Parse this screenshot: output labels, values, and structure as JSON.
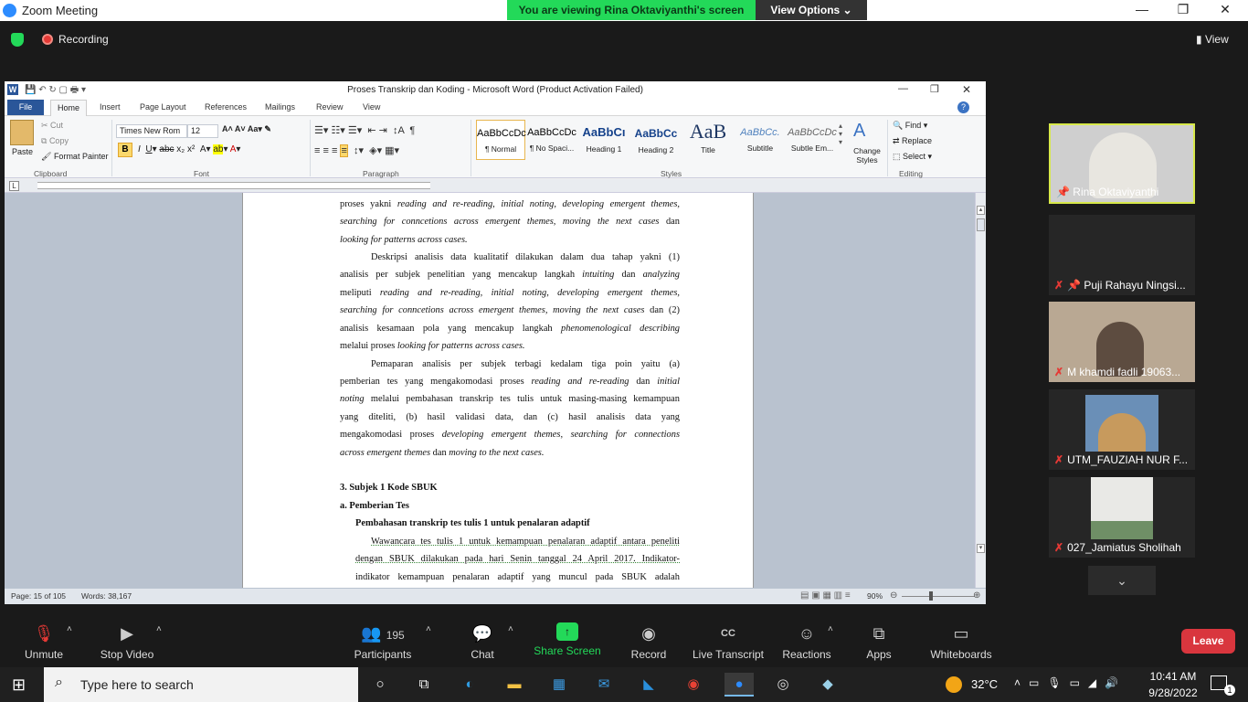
{
  "zoom": {
    "window_title": "Zoom Meeting",
    "viewing_banner": "You are viewing Rina Oktaviyanthi's screen",
    "view_options": "View Options",
    "recording": "Recording",
    "view_label": "View"
  },
  "word": {
    "title": "Proses Transkrip dan Koding  -  Microsoft Word (Product Activation Failed)",
    "tabs": [
      "File",
      "Home",
      "Insert",
      "Page Layout",
      "References",
      "Mailings",
      "Review",
      "View"
    ],
    "clipboard": {
      "paste": "Paste",
      "cut": "Cut",
      "copy": "Copy",
      "format_painter": "Format Painter",
      "group": "Clipboard"
    },
    "font": {
      "name": "Times New Rom",
      "size": "12",
      "group": "Font"
    },
    "paragraph_group": "Paragraph",
    "styles": [
      {
        "preview": "AaBbCcDc",
        "label": "¶ Normal"
      },
      {
        "preview": "AaBbCcDc",
        "label": "¶ No Spaci..."
      },
      {
        "preview": "AaBbCı",
        "label": "Heading 1"
      },
      {
        "preview": "AaBbCc",
        "label": "Heading 2"
      },
      {
        "preview": "AaB",
        "label": "Title"
      },
      {
        "preview": "AaBbCc.",
        "label": "Subtitle"
      },
      {
        "preview": "AaBbCcDc",
        "label": "Subtle Em..."
      }
    ],
    "styles_group": "Styles",
    "change_styles": "Change Styles",
    "editing": {
      "find": "Find",
      "replace": "Replace",
      "select": "Select",
      "group": "Editing"
    },
    "status": {
      "page": "Page: 15 of 105",
      "words": "Words: 38,167",
      "zoom": "90%"
    },
    "doc_lines": [
      "proses yakni <i>reading and re-reading, initial noting, developing emergent themes,</i>",
      "<i>searching for conncetions across emergent themes, moving the next cases</i> dan",
      "<i>looking for patterns across cases.</i>",
      "Deskripsi analisis data kualitatif dilakukan dalam dua tahap yakni (1)",
      "analisis per subjek penelitian yang mencakup langkah <i>intuiting</i> dan <i>analyzing</i>",
      "meliputi <i>reading and re-reading, initial noting, developing emergent themes,</i>",
      "<i>searching for conncetions across emergent themes, moving the next cases</i> dan (2)",
      "analisis kesamaan pola yang mencakup langkah <i>phenomenological describing</i>",
      "melalui proses <i>looking for patterns across cases.</i>",
      "Pemaparan analisis per subjek terbagi kedalam tiga poin yaitu (a)",
      "pemberian tes yang mengakomodasi proses <i>reading and re-reading</i> dan <i>initial</i>",
      "<i>noting</i> melalui pembahasan transkrip tes tulis untuk masing-masing kemampuan",
      "yang diteliti, (b) hasil validasi data, dan (c) hasil analisis data yang",
      "mengakomodasi proses <i>developing emergent themes, searching for connections</i>",
      "<i>across emergent themes</i> dan <i>moving to the next cases.</i>",
      "3.   Subjek 1 Kode SBUK",
      "a.   Pemberian  Tes",
      "Pembahasan  transkrip tes tulis 1 untuk penalaran adaptif",
      "Wawancara tes tulis 1 untuk kemampuan penalaran adaptif antara peneliti",
      "dengan SBUK dilakukan pada hari Senin tanggal 24 April 2017. Indikator-",
      "indikator kemampuan penalaran adaptif yang muncul pada SBUK adalah"
    ]
  },
  "participants": [
    {
      "name": "Rina Oktaviyanthi",
      "muted": false
    },
    {
      "name": "Puji Rahayu Ningsi...",
      "muted": true
    },
    {
      "name": "M khamdi fadli 19063...",
      "muted": true
    },
    {
      "name": "UTM_FAUZIAH NUR F...",
      "muted": true
    },
    {
      "name": "027_Jamiatus Sholihah",
      "muted": true
    }
  ],
  "toolbar": {
    "unmute": "Unmute",
    "stop_video": "Stop Video",
    "participants": "Participants",
    "participants_count": "195",
    "chat": "Chat",
    "share_screen": "Share Screen",
    "record": "Record",
    "live_transcript": "Live Transcript",
    "reactions": "Reactions",
    "apps": "Apps",
    "whiteboards": "Whiteboards",
    "leave": "Leave"
  },
  "taskbar": {
    "search_placeholder": "Type here to search",
    "temperature": "32°C",
    "time": "10:41 AM",
    "date": "9/28/2022",
    "notifications": "1"
  }
}
